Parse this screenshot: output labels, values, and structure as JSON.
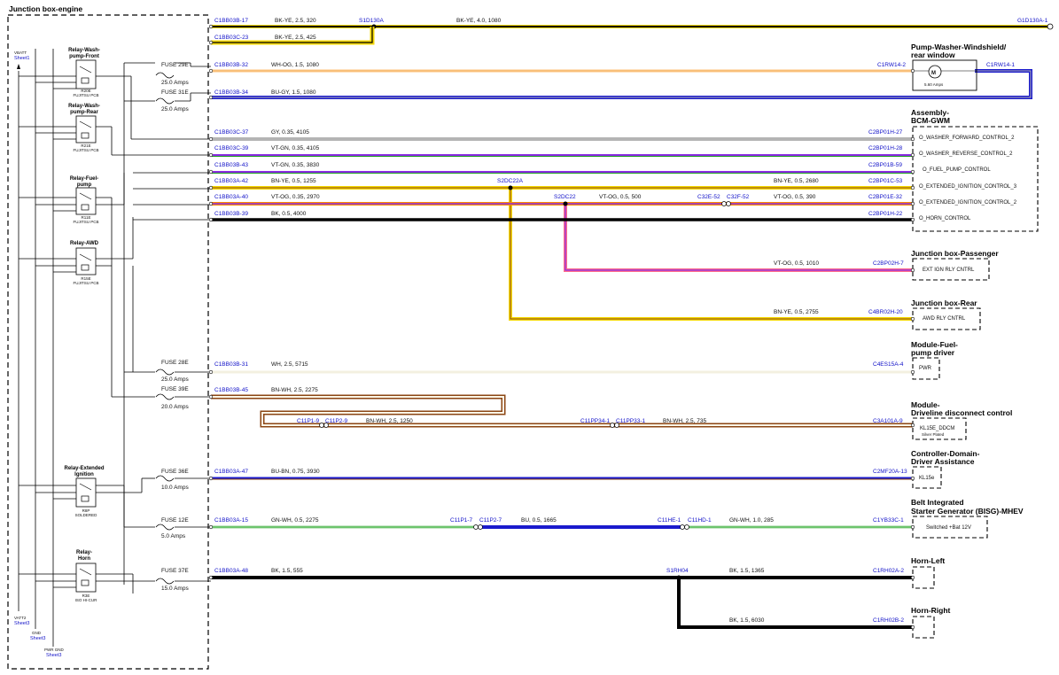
{
  "title": "Junction box-engine",
  "power_refs": [
    {
      "name": "VBATT",
      "sheet": "Sheet1"
    },
    {
      "name": "VATT2",
      "sheet": "Sheet3"
    },
    {
      "name": "GND",
      "sheet": "Sheet3"
    },
    {
      "name": "PWR GND",
      "sheet": "Sheet3"
    }
  ],
  "relays": [
    {
      "name": "Relay-Wash-pump-Front",
      "lines": [
        "Relay-Wash-",
        "pump-Front"
      ],
      "code": "R20E",
      "sub": "FUJITSU PCB"
    },
    {
      "name": "Relay-Wash-pump-Rear",
      "lines": [
        "Relay-Wash-",
        "pump-Rear"
      ],
      "code": "R21E",
      "sub": "FUJITSU PCB"
    },
    {
      "name": "Relay-Fuel-pump",
      "lines": [
        "Relay-Fuel-",
        "pump"
      ],
      "code": "R11E",
      "sub": "FUJITSU PCB"
    },
    {
      "name": "Relay-AWD",
      "lines": [
        "Relay-AWD"
      ],
      "code": "R15E",
      "sub": "FUJITSU PCB"
    },
    {
      "name": "Relay-Extended ignition",
      "lines": [
        "Relay-Extended",
        "Ignition"
      ],
      "code": "R8P",
      "sub": "SOLDERED"
    },
    {
      "name": "Relay-Horn",
      "lines": [
        "Relay-",
        "Horn"
      ],
      "code": "R3E",
      "sub": "ISO HI-CUR"
    }
  ],
  "fuses": [
    {
      "id": "FUSE 29E",
      "amps": "25.0 Amps"
    },
    {
      "id": "FUSE 31E",
      "amps": "25.0 Amps"
    },
    {
      "id": "FUSE 28E",
      "amps": "25.0 Amps"
    },
    {
      "id": "FUSE 39E",
      "amps": "20.0 Amps"
    },
    {
      "id": "FUSE 36E",
      "amps": "10.0 Amps"
    },
    {
      "id": "FUSE 12E",
      "amps": "5.0 Amps"
    },
    {
      "id": "FUSE 37E",
      "amps": "15.0 Amps"
    }
  ],
  "components": [
    {
      "name": "Pump-Washer-Windshield/rear window",
      "lines": [
        "Pump-Washer-Windshield/",
        "rear window"
      ],
      "signals": [
        "5.60 Amps"
      ]
    },
    {
      "name": "Assembly-BCM-GWM",
      "lines": [
        "Assembly-",
        "BCM-GWM"
      ],
      "signals": [
        "O_WASHER_FORWARD_CONTROL_2",
        "O_WASHER_REVERSE_CONTROL_2",
        "O_FUEL_PUMP_CONTROL",
        "O_EXTENDED_IGNITION_CONTROL_3",
        "O_EXTENDED_IGNITION_CONTROL_2",
        "O_HORN_CONTROL"
      ]
    },
    {
      "name": "Junction box-Passenger",
      "lines": [
        "Junction box-Passenger"
      ],
      "signals": [
        "EXT IGN RLY CNTRL"
      ]
    },
    {
      "name": "Junction box-Rear",
      "lines": [
        "Junction box-Rear"
      ],
      "signals": [
        "AWD RLY CNTRL"
      ]
    },
    {
      "name": "Module-Fuel-pump driver",
      "lines": [
        "Module-Fuel-",
        "pump driver"
      ],
      "signals": [
        "PWR"
      ]
    },
    {
      "name": "Module-Driveline disconnect control",
      "lines": [
        "Module-",
        "Driveline disconnect control"
      ],
      "signals": [
        "KL15E_DDCM",
        "Silver Plated"
      ]
    },
    {
      "name": "Controller-Domain-Driver Assistance",
      "lines": [
        "Controller-Domain-",
        "Driver Assistance"
      ],
      "signals": [
        "KL15e"
      ]
    },
    {
      "name": "Belt Integrated Starter Generator (BISG)-MHEV",
      "lines": [
        "Belt Integrated",
        "Starter Generator (BISG)-MHEV"
      ],
      "signals": [
        "Switched +Bat 12V"
      ]
    },
    {
      "name": "Horn-Left",
      "lines": [
        "Horn-Left"
      ],
      "signals": []
    },
    {
      "name": "Horn-Right",
      "lines": [
        "Horn-Right"
      ],
      "signals": []
    }
  ],
  "wires": [
    {
      "from": "C1BB03B-17",
      "label": "BK-YE, 2.5, 320",
      "splice": "S1D130A",
      "label2": "BK-YE, 4.0, 1080",
      "to": "G1D130A-1",
      "color": "#000000",
      "stripe": "#f5d800"
    },
    {
      "from": "C1BB03C-23",
      "label": "BK-YE, 2.5, 425",
      "color": "#000000",
      "stripe": "#f5d800"
    },
    {
      "from": "C1BB03B-32",
      "label": "WH-OG, 1.5, 1080",
      "to": "C1RW14-2",
      "to2": "C1RW14-1",
      "color": "#f2f2f2",
      "stripe": "#ff8c00"
    },
    {
      "from": "C1BB03B-34",
      "label": "BU-GY, 1.5, 1080",
      "color": "#1a1acd",
      "stripe": "#b0b0b0"
    },
    {
      "from": "C1BB03C-37",
      "label": "GY, 0.35, 4105",
      "to": "C2BP01H-27",
      "color": "#b4b4b4"
    },
    {
      "from": "C1BB03C-39",
      "label": "VT-GN, 0.35, 4105",
      "to": "C2BP01H-28",
      "color": "#8a2be2",
      "stripe": "#22a022"
    },
    {
      "from": "C1BB03B-43",
      "label": "VT-GN, 0.35, 3830",
      "to": "C2BP01B-59",
      "color": "#8a2be2",
      "stripe": "#22a022"
    },
    {
      "from": "C1BB03A-42",
      "label": "BN-YE, 0.5, 1255",
      "splice": "S2DC22A",
      "label2": "BN-YE, 0.5, 2680",
      "to": "C2BP01C-53",
      "color": "#8b4513",
      "stripe": "#f5d800"
    },
    {
      "from": "C1BB03A-40",
      "label": "VT-OG, 0.35, 2970",
      "splice": "S2DC22",
      "label2": "VT-OG, 0.5, 500",
      "mid": "C32E-52",
      "mid2": "C32F-52",
      "label3": "VT-OG, 0.5, 390",
      "to": "C2BP01E-32",
      "color": "#8a2be2",
      "stripe": "#ff8c00"
    },
    {
      "from": "C1BB03B-39",
      "label": "BK, 0.5, 4000",
      "to": "C2BP01H-22",
      "color": "#000000"
    },
    {
      "label": "VT-OG, 0.5, 1010",
      "to": "C2BP02H-7"
    },
    {
      "label": "BN-YE, 0.5, 2755",
      "to": "C4BR02H-20"
    },
    {
      "from": "C1BB03B-31",
      "label": "WH, 2.5, 5715",
      "to": "C4ES15A-4",
      "color": "#f5f5f5"
    },
    {
      "from": "C1BB03B-45",
      "label": "BN-WH, 2.5, 2275",
      "color": "#8b4513",
      "stripe": "#ffffff"
    },
    {
      "from": "C11P1-9",
      "from2": "C11P2-9",
      "label": "BN-WH, 2.5, 1250",
      "mid": "C11PP34-1",
      "mid2": "C11PP33-1",
      "label2": "BN-WH, 2.5, 735",
      "to": "C3A101A-9"
    },
    {
      "from": "C1BB03A-47",
      "label": "BU-BN, 0.75, 3930",
      "to": "C2MF20A-13",
      "color": "#1a1acd",
      "stripe": "#8b4513"
    },
    {
      "from": "C1BB03A-15",
      "label": "GN-WH, 0.5, 2275",
      "mid": "C11P1-7",
      "mid2": "C11P2-7",
      "label2": "BU, 0.5, 1665",
      "mid3": "C11HE-1",
      "mid4": "C11HD-1",
      "label3": "GN-WH, 1.0, 285",
      "to": "C1YB33C-1",
      "color": "#22a022",
      "stripe": "#ffffff"
    },
    {
      "from": "C1BB03A-48",
      "label": "BK, 1.5, 555",
      "splice": "S1RH04",
      "label2": "BK, 1.5, 1365",
      "to": "C1RH02A-2",
      "color": "#000000"
    },
    {
      "label": "BK, 1.5, 6030",
      "to": "C1RH02B-2"
    }
  ]
}
